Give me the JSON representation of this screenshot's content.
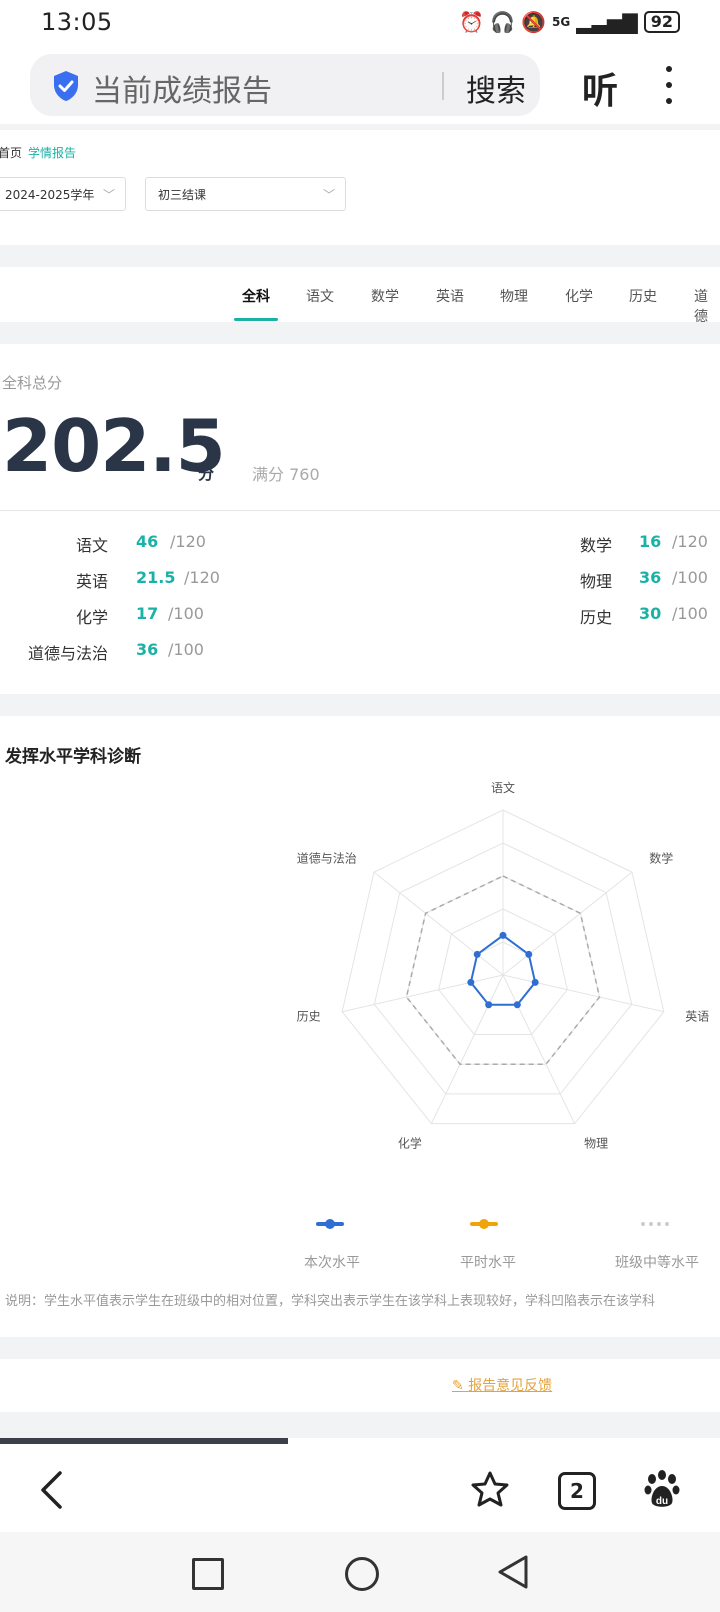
{
  "status": {
    "time": "13:05",
    "network": "5G",
    "battery": "92"
  },
  "browser": {
    "title": "当前成绩报告",
    "search_label": "搜索",
    "listen_label": "听"
  },
  "breadcrumb": {
    "home": "首页",
    "current": "学情报告"
  },
  "filters": {
    "year": "2024-2025学年",
    "exam": "初三结课"
  },
  "tabs": [
    "全科",
    "语文",
    "数学",
    "英语",
    "物理",
    "化学",
    "历史",
    "道德"
  ],
  "score": {
    "label": "全科总分",
    "total": "202.5",
    "unit": "分",
    "full": "满分 760"
  },
  "subjects": [
    {
      "name": "语文",
      "score": "46",
      "max": "/120"
    },
    {
      "name": "数学",
      "score": "16",
      "max": "/120"
    },
    {
      "name": "英语",
      "score": "21.5",
      "max": "/120"
    },
    {
      "name": "物理",
      "score": "36",
      "max": "/100"
    },
    {
      "name": "化学",
      "score": "17",
      "max": "/100"
    },
    {
      "name": "历史",
      "score": "30",
      "max": "/100"
    },
    {
      "name": "道德与法治",
      "score": "36",
      "max": "/100"
    }
  ],
  "radar": {
    "title": "发挥水平学科诊断",
    "axes": [
      "语文",
      "数学",
      "英语",
      "物理",
      "化学",
      "历史",
      "道德与法治"
    ],
    "legend": [
      "本次水平",
      "平时水平",
      "班级中等水平"
    ],
    "note": "说明：学生水平值表示学生在班级中的相对位置，学科突出表示学生在该学科上表现较好，学科凹陷表示在该学科"
  },
  "chart_data": {
    "type": "radar",
    "categories": [
      "语文",
      "数学",
      "英语",
      "物理",
      "化学",
      "历史",
      "道德与法治"
    ],
    "series": [
      {
        "name": "本次水平",
        "values": [
          0.24,
          0.2,
          0.2,
          0.2,
          0.2,
          0.2,
          0.2
        ],
        "color": "#2f6fd1"
      },
      {
        "name": "班级中等水平",
        "values": [
          0.6,
          0.6,
          0.6,
          0.6,
          0.6,
          0.6,
          0.6
        ],
        "color": "#bbbbbb"
      }
    ],
    "rings": 5
  },
  "feedback": "报告意见反馈",
  "colors": {
    "accent": "#1ab2a6",
    "primary_text": "#2a3548",
    "orange": "#e6a23c",
    "blue": "#2f6fd1"
  }
}
